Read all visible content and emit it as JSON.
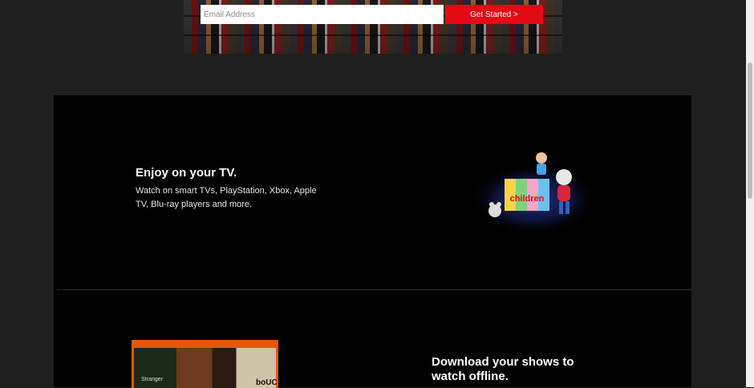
{
  "signup": {
    "email_placeholder": "Email Address",
    "cta_label": "Get Started >"
  },
  "tv_section": {
    "title": "Enjoy on your TV.",
    "description": "Watch on smart TVs, PlayStation, Xbox, Apple TV, Blu-ray players and more.",
    "illustration_label": "children"
  },
  "download_section": {
    "title": "Download your shows to watch offline.",
    "poster_label_left": "Stranger",
    "poster_label_right": "boUC"
  },
  "colors": {
    "accent": "#e50914",
    "background": "#1f1f1f",
    "panel": "#000000"
  }
}
